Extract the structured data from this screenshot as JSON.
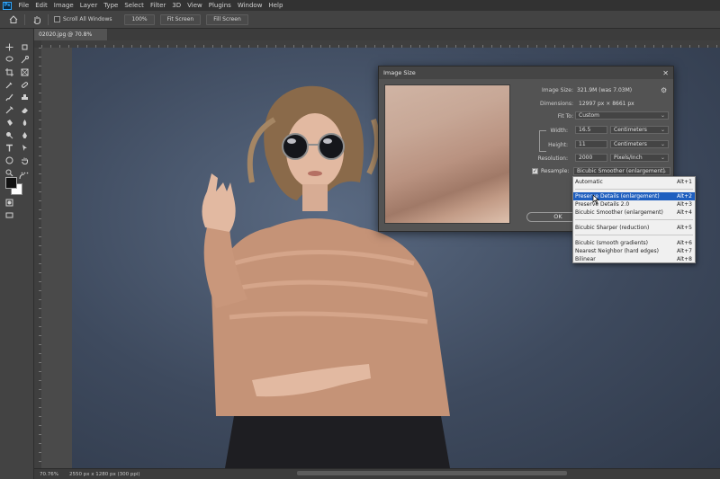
{
  "menu": [
    "File",
    "Edit",
    "Image",
    "Layer",
    "Type",
    "Select",
    "Filter",
    "3D",
    "View",
    "Plugins",
    "Window",
    "Help"
  ],
  "app_logo": "Ps",
  "options": {
    "scroll_all_windows": "Scroll All Windows",
    "zoom_btn": "100%",
    "fit_btn": "Fit Screen",
    "fill_btn": "Fill Screen"
  },
  "document": {
    "tab_title": "02020.jpg @ 70.8% (RGB/8)",
    "zoom": "70.76%",
    "info": "2550 px x 1280 px (300 ppi)"
  },
  "dialog": {
    "title": "Image Size",
    "image_size_label": "Image Size:",
    "image_size_value": "321.9M (was 7.03M)",
    "dimensions_label": "Dimensions:",
    "dimensions_value": "12997 px × 8661 px",
    "fit_to_label": "Fit To:",
    "fit_to_value": "Custom",
    "width_label": "Width:",
    "width_value": "16.5",
    "width_unit": "Centimeters",
    "height_label": "Height:",
    "height_value": "11",
    "height_unit": "Centimeters",
    "resolution_label": "Resolution:",
    "resolution_value": "2000",
    "resolution_unit": "Pixels/Inch",
    "resample_label": "Resample:",
    "resample_value": "Bicubic Smoother (enlargement)",
    "ok_label": "OK"
  },
  "resample_menu": [
    {
      "label": "Automatic",
      "shortcut": "Alt+1",
      "selected": false
    },
    {
      "label": "Preserve Details (enlargement)",
      "shortcut": "Alt+2",
      "selected": true
    },
    {
      "label": "Preserve Details 2.0",
      "shortcut": "Alt+3",
      "selected": false
    },
    {
      "label": "Bicubic Smoother (enlargement)",
      "shortcut": "Alt+4",
      "selected": false
    },
    {
      "label": "Bicubic Sharper (reduction)",
      "shortcut": "Alt+5",
      "selected": false
    },
    {
      "label": "Bicubic (smooth gradients)",
      "shortcut": "Alt+6",
      "selected": false
    },
    {
      "label": "Nearest Neighbor (hard edges)",
      "shortcut": "Alt+7",
      "selected": false
    },
    {
      "label": "Bilinear",
      "shortcut": "Alt+8",
      "selected": false
    }
  ],
  "colors": {
    "accent": "#31a8ff",
    "menu_selection": "#1f5fbf",
    "backdrop": "#3e4a5e",
    "blouse": "#c59377"
  }
}
